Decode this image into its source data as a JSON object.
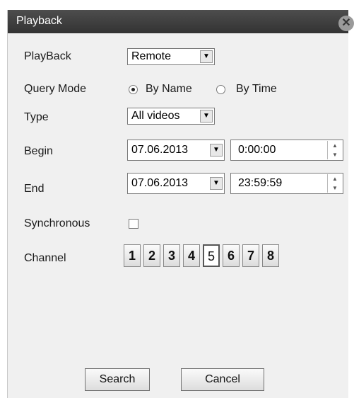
{
  "window": {
    "title": "Playback",
    "close": "✕"
  },
  "form": {
    "playback": {
      "label": "PlayBack",
      "value": "Remote"
    },
    "query_mode": {
      "label": "Query Mode",
      "by_name": "By Name",
      "by_time": "By Time",
      "selected": "By Name"
    },
    "type": {
      "label": "Type",
      "value": "All videos"
    },
    "begin": {
      "label": "Begin",
      "date": "07.06.2013",
      "time": "0:00:00"
    },
    "end": {
      "label": "End",
      "date": "07.06.2013",
      "time": "23:59:59"
    },
    "synchronous": {
      "label": "Synchronous",
      "checked": false
    },
    "channel": {
      "label": "Channel",
      "items": [
        "1",
        "2",
        "3",
        "4",
        "5",
        "6",
        "7",
        "8"
      ],
      "active": "5"
    }
  },
  "buttons": {
    "search": "Search",
    "cancel": "Cancel"
  },
  "icons": {
    "dropdown": "▼",
    "spin_up": "▲",
    "spin_down": "▼"
  },
  "colors": {
    "titlebar": "#3d3d3d",
    "dialog_bg": "#f0f0f0"
  }
}
